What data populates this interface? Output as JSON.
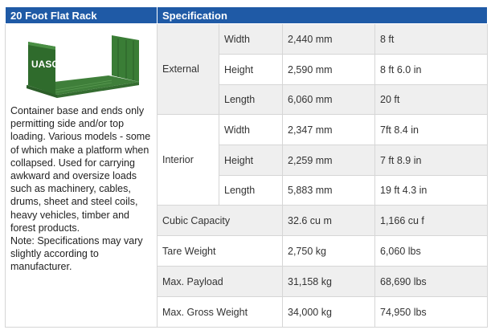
{
  "header": {
    "title": "20 Foot Flat Rack",
    "spec_title": "Specification"
  },
  "image": {
    "logo_text": "UASC",
    "body_color": "#2e7d32"
  },
  "description": "Container base and ends only permitting side and/or top loading. Various models - some of which make a platform when collapsed. Used for carrying awkward and oversize loads such as machinery, cables, drums, sheet and steel coils, heavy vehicles, timber and forest products.",
  "note": "Note: Specifications may vary slightly according to manufacturer.",
  "external": {
    "label": "External",
    "rows": [
      {
        "name": "Width",
        "metric": "2,440 mm",
        "imperial": "8 ft"
      },
      {
        "name": "Height",
        "metric": "2,590 mm",
        "imperial": "8 ft 6.0 in"
      },
      {
        "name": "Length",
        "metric": "6,060 mm",
        "imperial": "20 ft"
      }
    ]
  },
  "interior": {
    "label": "Interior",
    "rows": [
      {
        "name": "Width",
        "metric": "2,347 mm",
        "imperial": "7ft 8.4 in"
      },
      {
        "name": "Height",
        "metric": "2,259 mm",
        "imperial": "7 ft 8.9 in"
      },
      {
        "name": "Length",
        "metric": "5,883 mm",
        "imperial": "19 ft 4.3 in"
      }
    ]
  },
  "other_rows": [
    {
      "name": "Cubic Capacity",
      "metric": "32.6 cu m",
      "imperial": "1,166 cu f"
    },
    {
      "name": "Tare Weight",
      "metric": "2,750 kg",
      "imperial": "6,060 lbs"
    },
    {
      "name": "Max. Payload",
      "metric": "31,158 kg",
      "imperial": "68,690 lbs"
    },
    {
      "name": "Max. Gross Weight",
      "metric": "34,000 kg",
      "imperial": "74,950 lbs"
    }
  ]
}
